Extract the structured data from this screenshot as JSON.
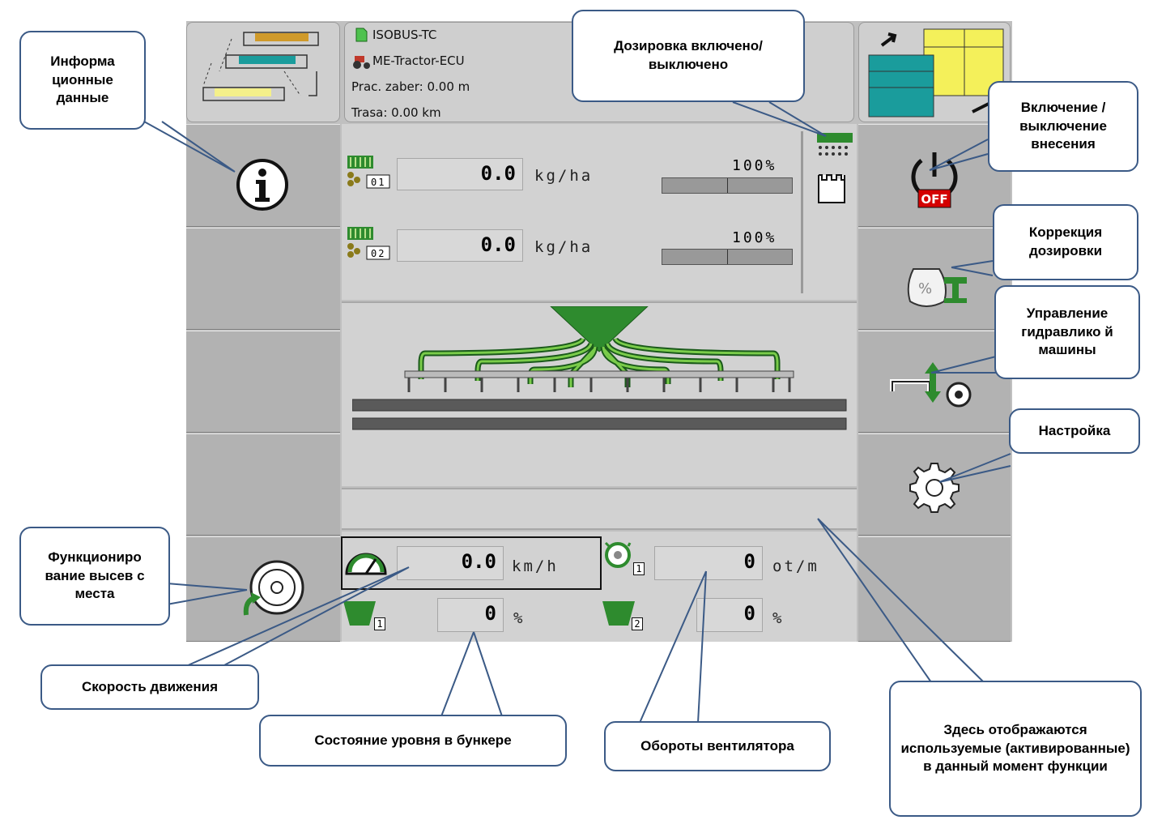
{
  "header": {
    "lines": [
      "ISOBUS-TC",
      "ME-Tractor-ECU",
      "Prac. zaber: 0.00  m",
      "Trasa: 0.00  km"
    ]
  },
  "metering": [
    {
      "index": "01",
      "value": "0.0",
      "unit": "kg/ha",
      "percent": "100%"
    },
    {
      "index": "02",
      "value": "0.0",
      "unit": "kg/ha",
      "percent": "100%"
    }
  ],
  "status": {
    "speed": {
      "value": "0.0",
      "unit": "km/h"
    },
    "fan": {
      "index": "1",
      "value": "0",
      "unit": "ot/m"
    },
    "hopper1": {
      "index": "1",
      "value": "0",
      "unit": "%"
    },
    "hopper2": {
      "index": "2",
      "value": "0",
      "unit": "%"
    }
  },
  "off_label": "OFF",
  "callouts": {
    "info": "Информа ционные данные",
    "dosing_onoff": "Дозировка включено/выключено",
    "application_onoff": "Включение / выключение внесения",
    "dosing_correction": "Коррекция дозировки",
    "hydraulics": "Управление гидравлико й машины",
    "settings": "Настройка",
    "seed_start": "Функциониро вание высев с места",
    "speed": "Скорость движения",
    "hopper_level": "Состояние уровня в бункере",
    "fan_speed": "Обороты вентилятора",
    "active_functions": "Здесь отображаются используемые (активированные) в данный момент функции"
  },
  "icons": [
    "info-icon",
    "power-off-icon",
    "dosing-correction-icon",
    "hydraulics-icon",
    "settings-gear-icon",
    "seed-start-wheel-icon",
    "speedometer-icon",
    "fan-icon",
    "hopper-icon",
    "metering-unit-icon",
    "seed-drill-icon",
    "field-switch-icon",
    "job-icon",
    "tractor-icon"
  ],
  "colors": {
    "accent_green": "#2e8b2e",
    "background_gray": "#c0c0c0",
    "callout_border": "#3b5a86",
    "off_red": "#d40000"
  }
}
